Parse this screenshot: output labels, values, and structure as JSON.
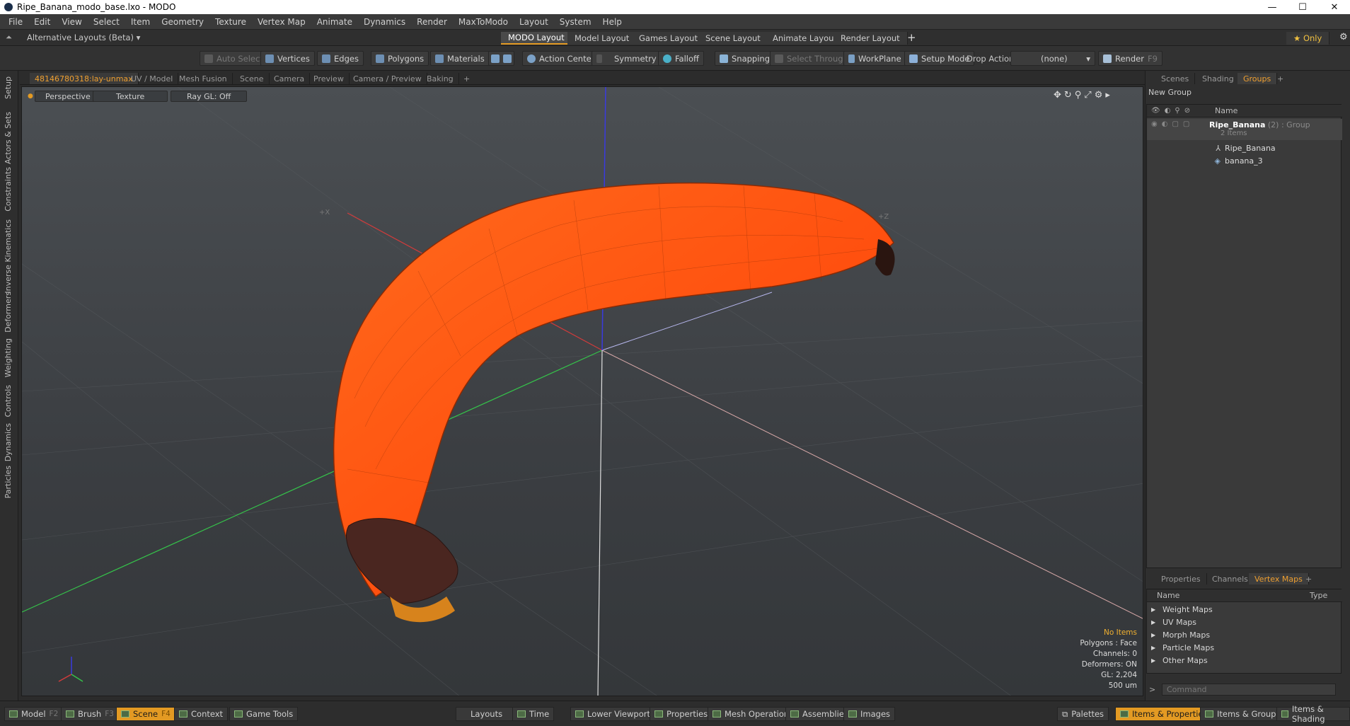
{
  "window": {
    "title": "Ripe_Banana_modo_base.lxo - MODO",
    "minimize": "—",
    "maximize": "☐",
    "close": "✕"
  },
  "menu": [
    "File",
    "Edit",
    "View",
    "Select",
    "Item",
    "Geometry",
    "Texture",
    "Vertex Map",
    "Animate",
    "Dynamics",
    "Render",
    "MaxToModo",
    "Layout",
    "System",
    "Help"
  ],
  "layoutbar": {
    "switcher": "Alternative Layouts (Beta) ▾",
    "tabs": [
      "MODO Layout",
      "Model Layout",
      "Games Layout",
      "Scene Layout",
      "Animate Layout",
      "Render Layout"
    ],
    "add": "+",
    "only": "★ Only"
  },
  "toolbar": {
    "auto_select": "Auto Select",
    "vertices": "Vertices",
    "edges": "Edges",
    "polygons": "Polygons",
    "materials": "Materials",
    "action_center": "Action Center",
    "symmetry": "Symmetry",
    "falloff": "Falloff",
    "snapping": "Snapping",
    "select_through": "Select Through",
    "workplane": "WorkPlane",
    "setup_mode": "Setup Mode",
    "drop_action": "Drop Action",
    "drop_value": "(none)",
    "render": "Render",
    "render_key": "F9"
  },
  "left_strip": [
    "Setup",
    "Actors & Sets",
    "Constraints",
    "Inverse Kinematics",
    "Deformers",
    "Weighting",
    "Controls",
    "Dynamics",
    "Particles"
  ],
  "viewport_tabs": [
    "48146780318:lay-unmax",
    "UV / Model",
    "Mesh Fusion",
    "Scene",
    "Camera",
    "Preview",
    "Camera / Preview",
    "Baking",
    "+"
  ],
  "viewport": {
    "projection": "Perspective",
    "shading": "Texture",
    "raygl": "Ray GL: Off",
    "axis_x": "+X",
    "axis_z": "+Z",
    "info": {
      "items": "No Items",
      "polygons": "Polygons : Face",
      "channels": "Channels: 0",
      "deformers": "Deformers: ON",
      "gl": "GL: 2,204",
      "scale": "500 um"
    }
  },
  "right_tabs_top": [
    "Scenes",
    "Shading",
    "Groups",
    "+"
  ],
  "groups": {
    "new_group": "New Group",
    "col_name": "Name",
    "root_name": "Ripe_Banana",
    "root_suffix": "(2) : Group",
    "root_count": "2 Items",
    "children": [
      "Ripe_Banana",
      "banana_3"
    ]
  },
  "right_tabs_bottom": [
    "Properties",
    "Channels",
    "Vertex Maps",
    "+"
  ],
  "vertex_maps": {
    "col_name": "Name",
    "col_type": "Type",
    "items": [
      "Weight Maps",
      "UV Maps",
      "Morph Maps",
      "Particle Maps",
      "Other Maps"
    ]
  },
  "command": {
    "prompt": ">",
    "placeholder": "Command"
  },
  "bottom": {
    "model": "Model",
    "model_key": "F2",
    "brush": "Brush",
    "brush_key": "F3",
    "scene": "Scene",
    "scene_key": "F4",
    "context": "Context",
    "game_tools": "Game Tools",
    "layouts": "Layouts",
    "time": "Time",
    "lower_viewports": "Lower Viewports",
    "properties": "Properties",
    "mesh_operations": "Mesh Operations",
    "assemblies": "Assemblies",
    "images": "Images",
    "palettes": "Palettes",
    "items_properties": "Items & Properties",
    "items_groups": "Items & Groups",
    "items_shading": "Items & Shading"
  },
  "colors": {
    "accent": "#e39a23",
    "banana": "#ff5a12",
    "axis_x": "#d23b3b",
    "axis_y": "#3a3adf",
    "axis_z": "#35c24a"
  }
}
